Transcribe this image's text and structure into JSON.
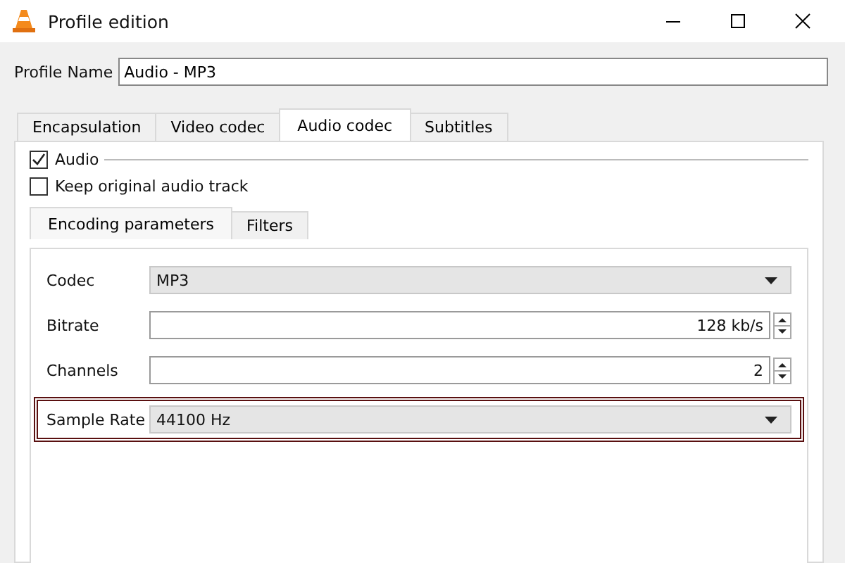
{
  "window": {
    "title": "Profile edition"
  },
  "profile_name": {
    "label": "Profile Name",
    "value": "Audio - MP3"
  },
  "tabs": [
    {
      "label": "Encapsulation",
      "selected": false
    },
    {
      "label": "Video codec",
      "selected": false
    },
    {
      "label": "Audio codec",
      "selected": true
    },
    {
      "label": "Subtitles",
      "selected": false
    }
  ],
  "audio": {
    "label": "Audio",
    "checked": true
  },
  "keep_original": {
    "label": "Keep original audio track",
    "checked": false
  },
  "sub_tabs": [
    {
      "label": "Encoding parameters",
      "selected": true
    },
    {
      "label": "Filters",
      "selected": false
    }
  ],
  "fields": [
    {
      "kind": "dropdown",
      "label": "Codec",
      "value": "MP3",
      "highlighted": false
    },
    {
      "kind": "spin",
      "label": "Bitrate",
      "value": "128 kb/s",
      "highlighted": false
    },
    {
      "kind": "spin",
      "label": "Channels",
      "value": "2",
      "highlighted": false
    },
    {
      "kind": "dropdown",
      "label": "Sample Rate",
      "value": "44100 Hz",
      "highlighted": true
    }
  ]
}
